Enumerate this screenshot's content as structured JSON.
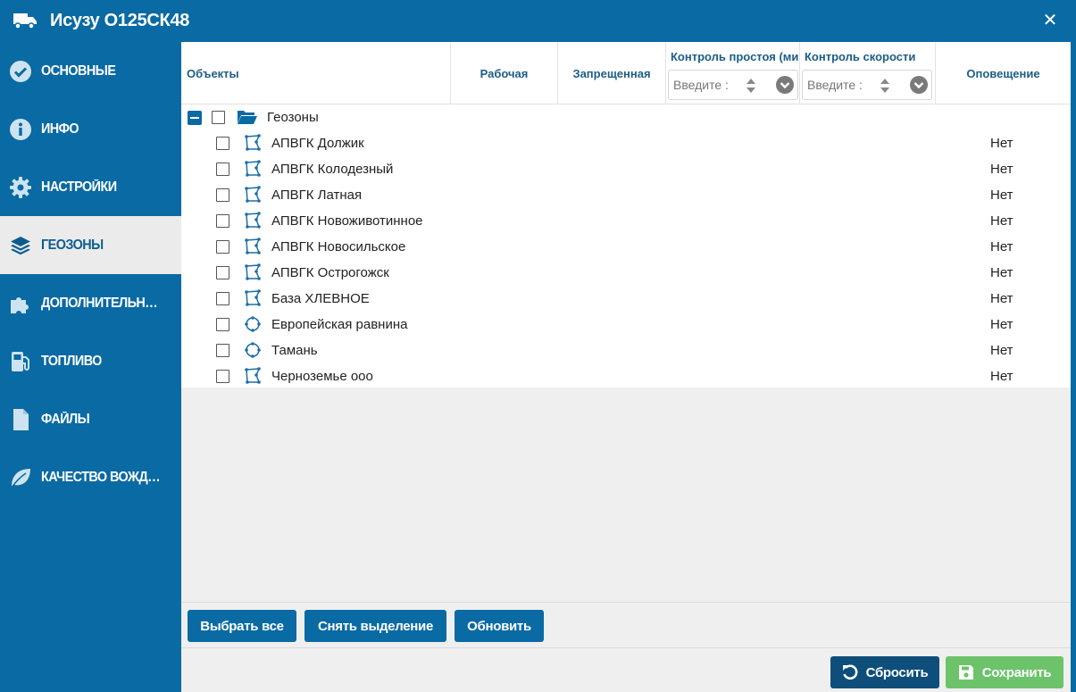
{
  "window": {
    "title": "Исузу О125СК48",
    "title_icon": "truck-icon",
    "close_icon": "close-icon"
  },
  "sidebar": {
    "items": [
      {
        "label": "ОСНОВНЫЕ",
        "icon": "check-circle-icon",
        "active": false
      },
      {
        "label": "ИНФО",
        "icon": "info-circle-icon",
        "active": false
      },
      {
        "label": "НАСТРОЙКИ",
        "icon": "gear-icon",
        "active": false
      },
      {
        "label": "ГЕОЗОНЫ",
        "icon": "layers-icon",
        "active": true
      },
      {
        "label": "ДОПОЛНИТЕЛЬНЫЕ П...",
        "icon": "puzzle-icon",
        "active": false
      },
      {
        "label": "ТОПЛИВО",
        "icon": "fuel-pump-icon",
        "active": false
      },
      {
        "label": "ФАЙЛЫ",
        "icon": "file-icon",
        "active": false
      },
      {
        "label": "КАЧЕСТВО ВОЖДЕНИЯ",
        "icon": "leaf-icon",
        "active": false
      }
    ]
  },
  "table": {
    "columns": {
      "objects": "Объекты",
      "working": "Рабочая",
      "forbidden": "Запрещенная",
      "idle_control": "Контроль простоя (ми",
      "speed_control": "Контроль скорости",
      "notification": "Оповещение"
    },
    "idle_input": {
      "placeholder": "Введите :",
      "value": ""
    },
    "speed_input": {
      "placeholder": "Введите :",
      "value": ""
    },
    "group": {
      "label": "Геозоны",
      "icon": "folder-open-icon"
    },
    "rows": [
      {
        "name": "АПВГК Должик",
        "icon": "polygon-icon",
        "alert": "Нет"
      },
      {
        "name": "АПВГК Колодезный",
        "icon": "polygon-icon",
        "alert": "Нет"
      },
      {
        "name": "АПВГК Латная",
        "icon": "polygon-icon",
        "alert": "Нет"
      },
      {
        "name": "АПВГК Новоживотинное",
        "icon": "polygon-icon",
        "alert": "Нет"
      },
      {
        "name": "АПВГК Новосильское",
        "icon": "polygon-icon",
        "alert": "Нет"
      },
      {
        "name": "АПВГК Острогожск",
        "icon": "polygon-icon",
        "alert": "Нет"
      },
      {
        "name": "База ХЛЕВНОЕ",
        "icon": "polygon-icon",
        "alert": "Нет"
      },
      {
        "name": "Европейская равнина",
        "icon": "circle-zone-icon",
        "alert": "Нет"
      },
      {
        "name": "Тамань",
        "icon": "circle-zone-icon",
        "alert": "Нет"
      },
      {
        "name": "Черноземье ооо",
        "icon": "polygon-icon",
        "alert": "Нет"
      }
    ]
  },
  "actions": {
    "select_all": "Выбрать все",
    "deselect": "Снять выделение",
    "refresh": "Обновить"
  },
  "footer": {
    "reset": "Сбросить",
    "save": "Сохранить"
  },
  "colors": {
    "primary": "#0a6aa3",
    "navy": "#0d4f7a",
    "success": "#6cc36a",
    "header_text": "#1d5d87"
  }
}
